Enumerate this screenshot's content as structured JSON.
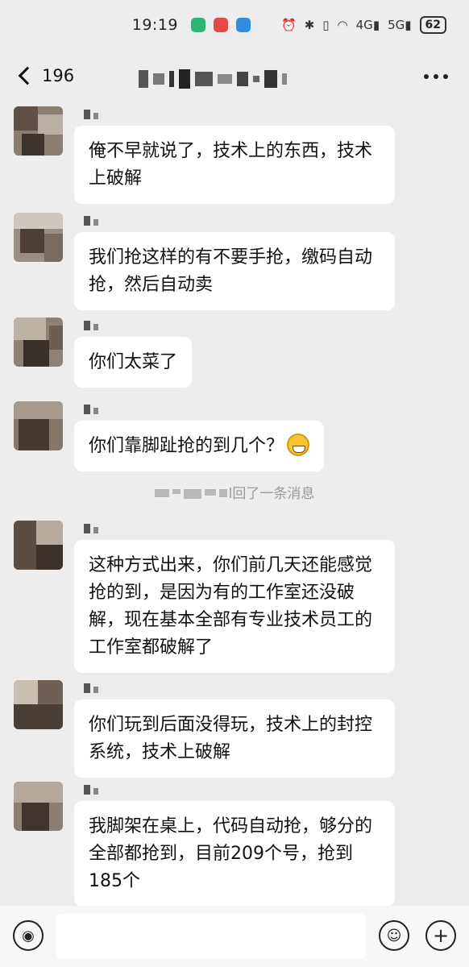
{
  "status_bar": {
    "time": "19:19",
    "icons": [
      "app-icon-green",
      "app-icon-red",
      "app-icon-blue",
      "alarm-icon",
      "bluetooth-icon",
      "vibrate-icon",
      "wifi-icon",
      "signal-4g-icon",
      "signal-5g-icon"
    ],
    "signal_4g": "4G",
    "signal_5g": "5G",
    "battery": "62"
  },
  "nav": {
    "back_count": "196",
    "title_obscured": true,
    "more_icon": "more-dots-icon"
  },
  "messages": [
    {
      "text": "俺不早就说了，技术上的东西，技术上破解"
    },
    {
      "text": "我们抢这样的有不要手抢，缴码自动抢，然后自动卖"
    },
    {
      "text": "你们太菜了"
    },
    {
      "text": "你们靠脚趾抢的到几个？",
      "emoji": "grinning-face-icon"
    },
    {
      "text": "这种方式出来，你们前几天还能感觉抢的到，是因为有的工作室还没破解，现在基本全部有专业技术员工的工作室都破解了"
    },
    {
      "text": "你们玩到后面没得玩，技术上的封控系统，技术上破解"
    },
    {
      "text": "我脚架在桌上，代码自动抢，够分的全部都抢到，目前209个号，抢到185个"
    }
  ],
  "system_notice": {
    "text": "撤回了一条消息",
    "visible_text": "l回了一条消息"
  },
  "input_bar": {
    "voice_icon": "voice-icon",
    "emoji_icon": "emoji-icon",
    "add_icon": "plus-icon",
    "value": ""
  },
  "colors": {
    "background": "#ededed",
    "bubble": "#ffffff",
    "notice_text": "#9a9a9a"
  }
}
